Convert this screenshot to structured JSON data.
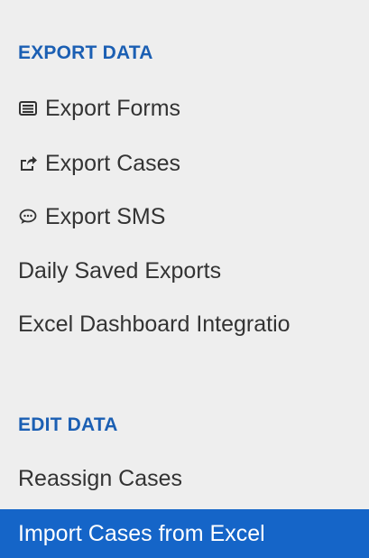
{
  "sections": [
    {
      "header": "EXPORT DATA",
      "items": [
        {
          "label": "Export Forms",
          "icon": "list-icon"
        },
        {
          "label": "Export Cases",
          "icon": "share-icon"
        },
        {
          "label": "Export SMS",
          "icon": "comment-icon"
        },
        {
          "label": "Daily Saved Exports"
        },
        {
          "label": "Excel Dashboard Integratio"
        }
      ]
    },
    {
      "header": "EDIT DATA",
      "items": [
        {
          "label": "Reassign Cases"
        },
        {
          "label": "Import Cases from Excel",
          "active": true
        }
      ]
    }
  ],
  "colors": {
    "background": "#eeeeee",
    "section_header": "#1b5fb3",
    "text": "#333333",
    "active_bg": "#1565c8",
    "active_text": "#ffffff"
  }
}
